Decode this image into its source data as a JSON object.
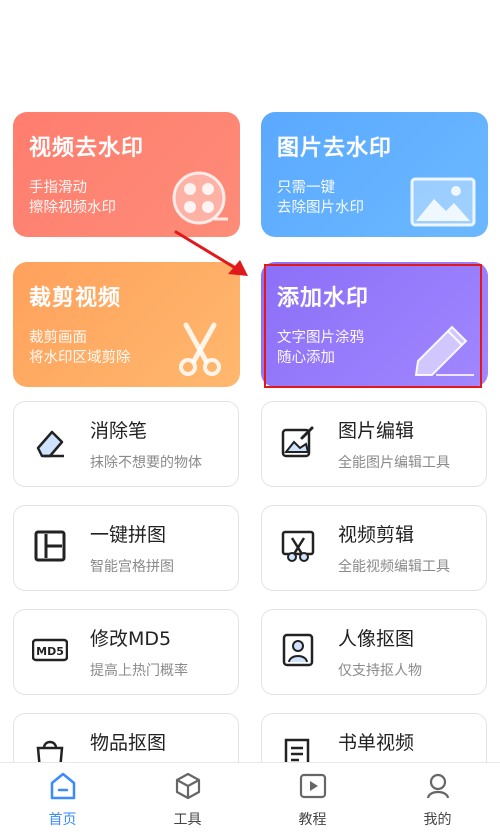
{
  "feature_cards": {
    "video_watermark": {
      "title": "视频去水印",
      "line1": "手指滑动",
      "line2": "擦除视频水印"
    },
    "image_watermark": {
      "title": "图片去水印",
      "line1": "只需一键",
      "line2": "去除图片水印"
    },
    "crop_video": {
      "title": "裁剪视频",
      "line1": "裁剪画面",
      "line2": "将水印区域剪除"
    },
    "add_watermark": {
      "title": "添加水印",
      "line1": "文字图片涂鸦",
      "line2": "随心添加"
    }
  },
  "tools": [
    {
      "title": "消除笔",
      "subtitle": "抹除不想要的物体",
      "icon": "eraser-icon"
    },
    {
      "title": "图片编辑",
      "subtitle": "全能图片编辑工具",
      "icon": "image-edit-icon"
    },
    {
      "title": "一键拼图",
      "subtitle": "智能宫格拼图",
      "icon": "collage-icon"
    },
    {
      "title": "视频剪辑",
      "subtitle": "全能视频编辑工具",
      "icon": "video-cut-icon"
    },
    {
      "title": "修改MD5",
      "subtitle": "提高上热门概率",
      "icon": "md5-icon"
    },
    {
      "title": "人像抠图",
      "subtitle": "仅支持抠人物",
      "icon": "portrait-cutout-icon"
    },
    {
      "title": "物品抠图",
      "subtitle": "",
      "icon": "object-cutout-icon"
    },
    {
      "title": "书单视频",
      "subtitle": "",
      "icon": "booklist-video-icon"
    }
  ],
  "md5_badge": "MD5",
  "tabbar": {
    "items": [
      {
        "label": "首页",
        "icon": "home-icon",
        "active": true
      },
      {
        "label": "工具",
        "icon": "cube-icon",
        "active": false
      },
      {
        "label": "教程",
        "icon": "play-icon",
        "active": false
      },
      {
        "label": "我的",
        "icon": "user-icon",
        "active": false
      }
    ]
  },
  "colors": {
    "video_card": "#ff7d6e",
    "image_card": "#5aa9ff",
    "crop_card": "#ffa15c",
    "add_card": "#8b6ff7",
    "highlight_border": "#e01a1a",
    "active_tab": "#3a8bff"
  }
}
